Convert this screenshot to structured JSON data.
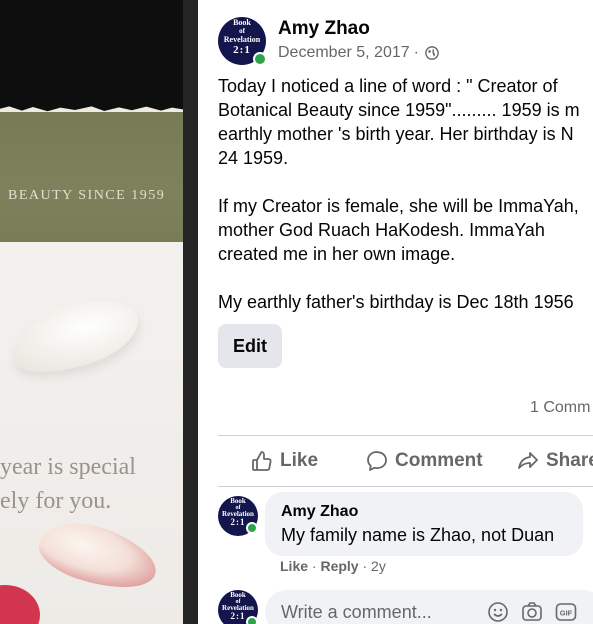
{
  "photo": {
    "band_text": "BEAUTY SINCE 1959",
    "line1": "year is special",
    "line2": "ely for you."
  },
  "post": {
    "author": "Amy Zhao",
    "date": "December 5, 2017",
    "separator": "·",
    "avatar_logo": {
      "line1": "Book",
      "line2": "of",
      "line3": "Revelation",
      "line4": "2:1"
    },
    "paragraphs": [
      {
        "lines": [
          "Today I noticed a line of word : \" Creator of",
          "Botanical Beauty since 1959\"......... 1959 is m",
          "earthly mother 's birth year. Her birthday is N",
          "24 1959."
        ]
      },
      {
        "lines": [
          "If my Creator is female, she will be ImmaYah,",
          "mother God Ruach HaKodesh. ImmaYah",
          "created me in her own image."
        ]
      },
      {
        "lines": [
          "My earthly father's birthday is Dec 18th 1956"
        ]
      }
    ],
    "edit_label": "Edit",
    "comment_count": "1 Comm",
    "actions": {
      "like": "Like",
      "comment": "Comment",
      "share": "Share"
    }
  },
  "comment": {
    "author": "Amy Zhao",
    "text": "My family name is Zhao, not Duan",
    "like": "Like",
    "reply": "Reply",
    "dot": "·",
    "age": "2y"
  },
  "composer": {
    "placeholder": "Write a comment...",
    "gif": "GIF"
  },
  "colors": {
    "logo": "#13154d",
    "online": "#31a24c",
    "muted": "#65676b",
    "bubble": "#f0f2f5",
    "button": "#e4e6eb"
  }
}
